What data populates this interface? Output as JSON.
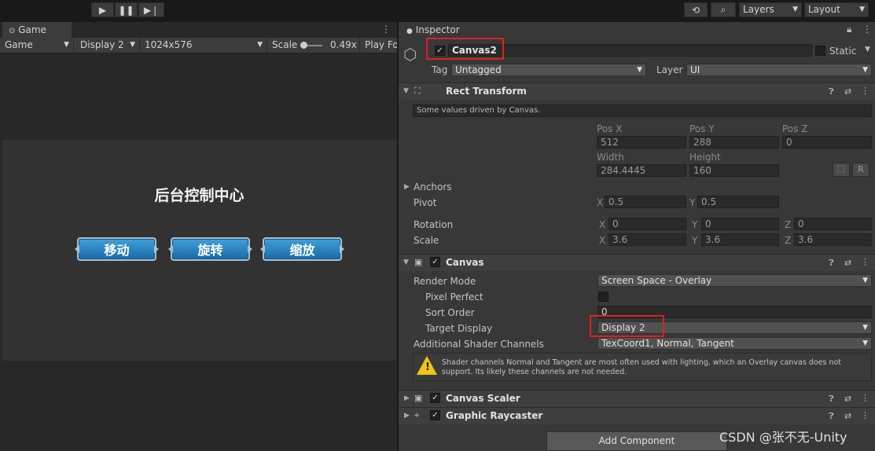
{
  "toolbar": {
    "play_icon": "play-icon",
    "pause_icon": "pause-icon",
    "step_icon": "step-icon",
    "layers_label": "Layers",
    "layout_label": "Layout"
  },
  "game": {
    "tab_label": "Game",
    "bar": {
      "view_label": "Game",
      "display_label": "Display 2",
      "resolution_label": "1024x576",
      "scale_label": "Scale",
      "scale_value": "0.49x",
      "play_focused_label": "Play Fo"
    },
    "title": "后台控制中心",
    "buttons": [
      "移动",
      "旋转",
      "缩放"
    ]
  },
  "inspector": {
    "tab_label": "Inspector",
    "object_name": "Canvas2",
    "static_label": "Static",
    "tag_label": "Tag",
    "tag_value": "Untagged",
    "layer_label": "Layer",
    "layer_value": "UI",
    "rect_transform": {
      "title": "Rect Transform",
      "note": "Some values driven by Canvas.",
      "posx_label": "Pos X",
      "posx": "512",
      "posy_label": "Pos Y",
      "posy": "288",
      "posz_label": "Pos Z",
      "posz": "0",
      "width_label": "Width",
      "width": "284.4445",
      "height_label": "Height",
      "height": "160",
      "r_button": "R",
      "anchors_label": "Anchors",
      "pivot_label": "Pivot",
      "pivot_x_label": "X",
      "pivot_x": "0.5",
      "pivot_y_label": "Y",
      "pivot_y": "0.5",
      "rotation_label": "Rotation",
      "rot_x_label": "X",
      "rot_x": "0",
      "rot_y_label": "Y",
      "rot_y": "0",
      "rot_z_label": "Z",
      "rot_z": "0",
      "scale_label": "Scale",
      "scale_x_label": "X",
      "scale_x": "3.6",
      "scale_y_label": "Y",
      "scale_y": "3.6",
      "scale_z_label": "Z",
      "scale_z": "3.6"
    },
    "canvas": {
      "title": "Canvas",
      "render_mode_label": "Render Mode",
      "render_mode_value": "Screen Space - Overlay",
      "pixel_perfect_label": "Pixel Perfect",
      "sort_order_label": "Sort Order",
      "sort_order_value": "0",
      "target_display_label": "Target Display",
      "target_display_value": "Display 2",
      "shader_channels_label": "Additional Shader Channels",
      "shader_channels_value": "TexCoord1, Normal, Tangent",
      "warning": "Shader channels Normal and Tangent are most often used with lighting, which an Overlay canvas does not support. Its likely these channels are not needed."
    },
    "canvas_scaler_title": "Canvas Scaler",
    "graphic_raycaster_title": "Graphic Raycaster",
    "add_component_label": "Add Component"
  },
  "watermark": "CSDN @张不无-Unity",
  "colors": {
    "highlight": "#e02020",
    "button_blue": "#1b69a8",
    "warning_yellow": "#f0c419"
  }
}
